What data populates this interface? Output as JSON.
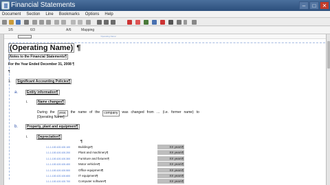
{
  "window": {
    "title": "Financial Statements"
  },
  "menu": [
    "Document",
    "Section",
    "Line",
    "Bookmarks",
    "Options",
    "Help"
  ],
  "status": {
    "c1": "1/5",
    "c2": "6/3",
    "c3": "A/6",
    "c4": "Mapping"
  },
  "ruler": {
    "header_text": "'Operating Name'"
  },
  "doc": {
    "name_field": "(Operating Name)",
    "pilcrow": "¶",
    "notes_title": "Notes to the Financial Statements¶",
    "period": "For the Year Ended December 31, 2008",
    "sections": [
      {
        "num": "1.",
        "label": "Significant Accounting Policies¶"
      },
      {
        "num": "a.",
        "label": "Entity information¶"
      },
      {
        "num": "i.",
        "label": "Name changes¶"
      },
      {
        "num": "b.",
        "label": "Property, plant and equipment¶"
      },
      {
        "num": "i.",
        "label": "Depreciation¶"
      }
    ],
    "para": {
      "line1": [
        "During",
        "the",
        "year,",
        "the",
        "name",
        "of",
        "the",
        "company",
        "was",
        "changed",
        "from",
        "…",
        "(i.e.",
        "former",
        "name)",
        "to"
      ],
      "line2": "[Operating Name]."
    },
    "assets": [
      {
        "code": "1.1.1.100.100.100.100",
        "label": "Buildings¶",
        "value": "XX years¶"
      },
      {
        "code": "1.1.1.100.100.100.200",
        "label": "Plant and machinery¶",
        "value": "XX years¶"
      },
      {
        "code": "1.1.1.100.100.100.300",
        "label": "Furniture and fixtures¶",
        "value": "XX years¶"
      },
      {
        "code": "1.1.1.100.100.100.400",
        "label": "Motor vehicles¶",
        "value": "XX years¶"
      },
      {
        "code": "1.1.1.100.100.100.500",
        "label": "Office equipment¶",
        "value": "XX years¶"
      },
      {
        "code": "1.1.1.100.100.100.600",
        "label": "IT equipment¶",
        "value": "XX years¶"
      },
      {
        "code": "1.1.1.100.100.100.700",
        "label": "Computer software¶",
        "value": "XX years¶"
      }
    ]
  }
}
